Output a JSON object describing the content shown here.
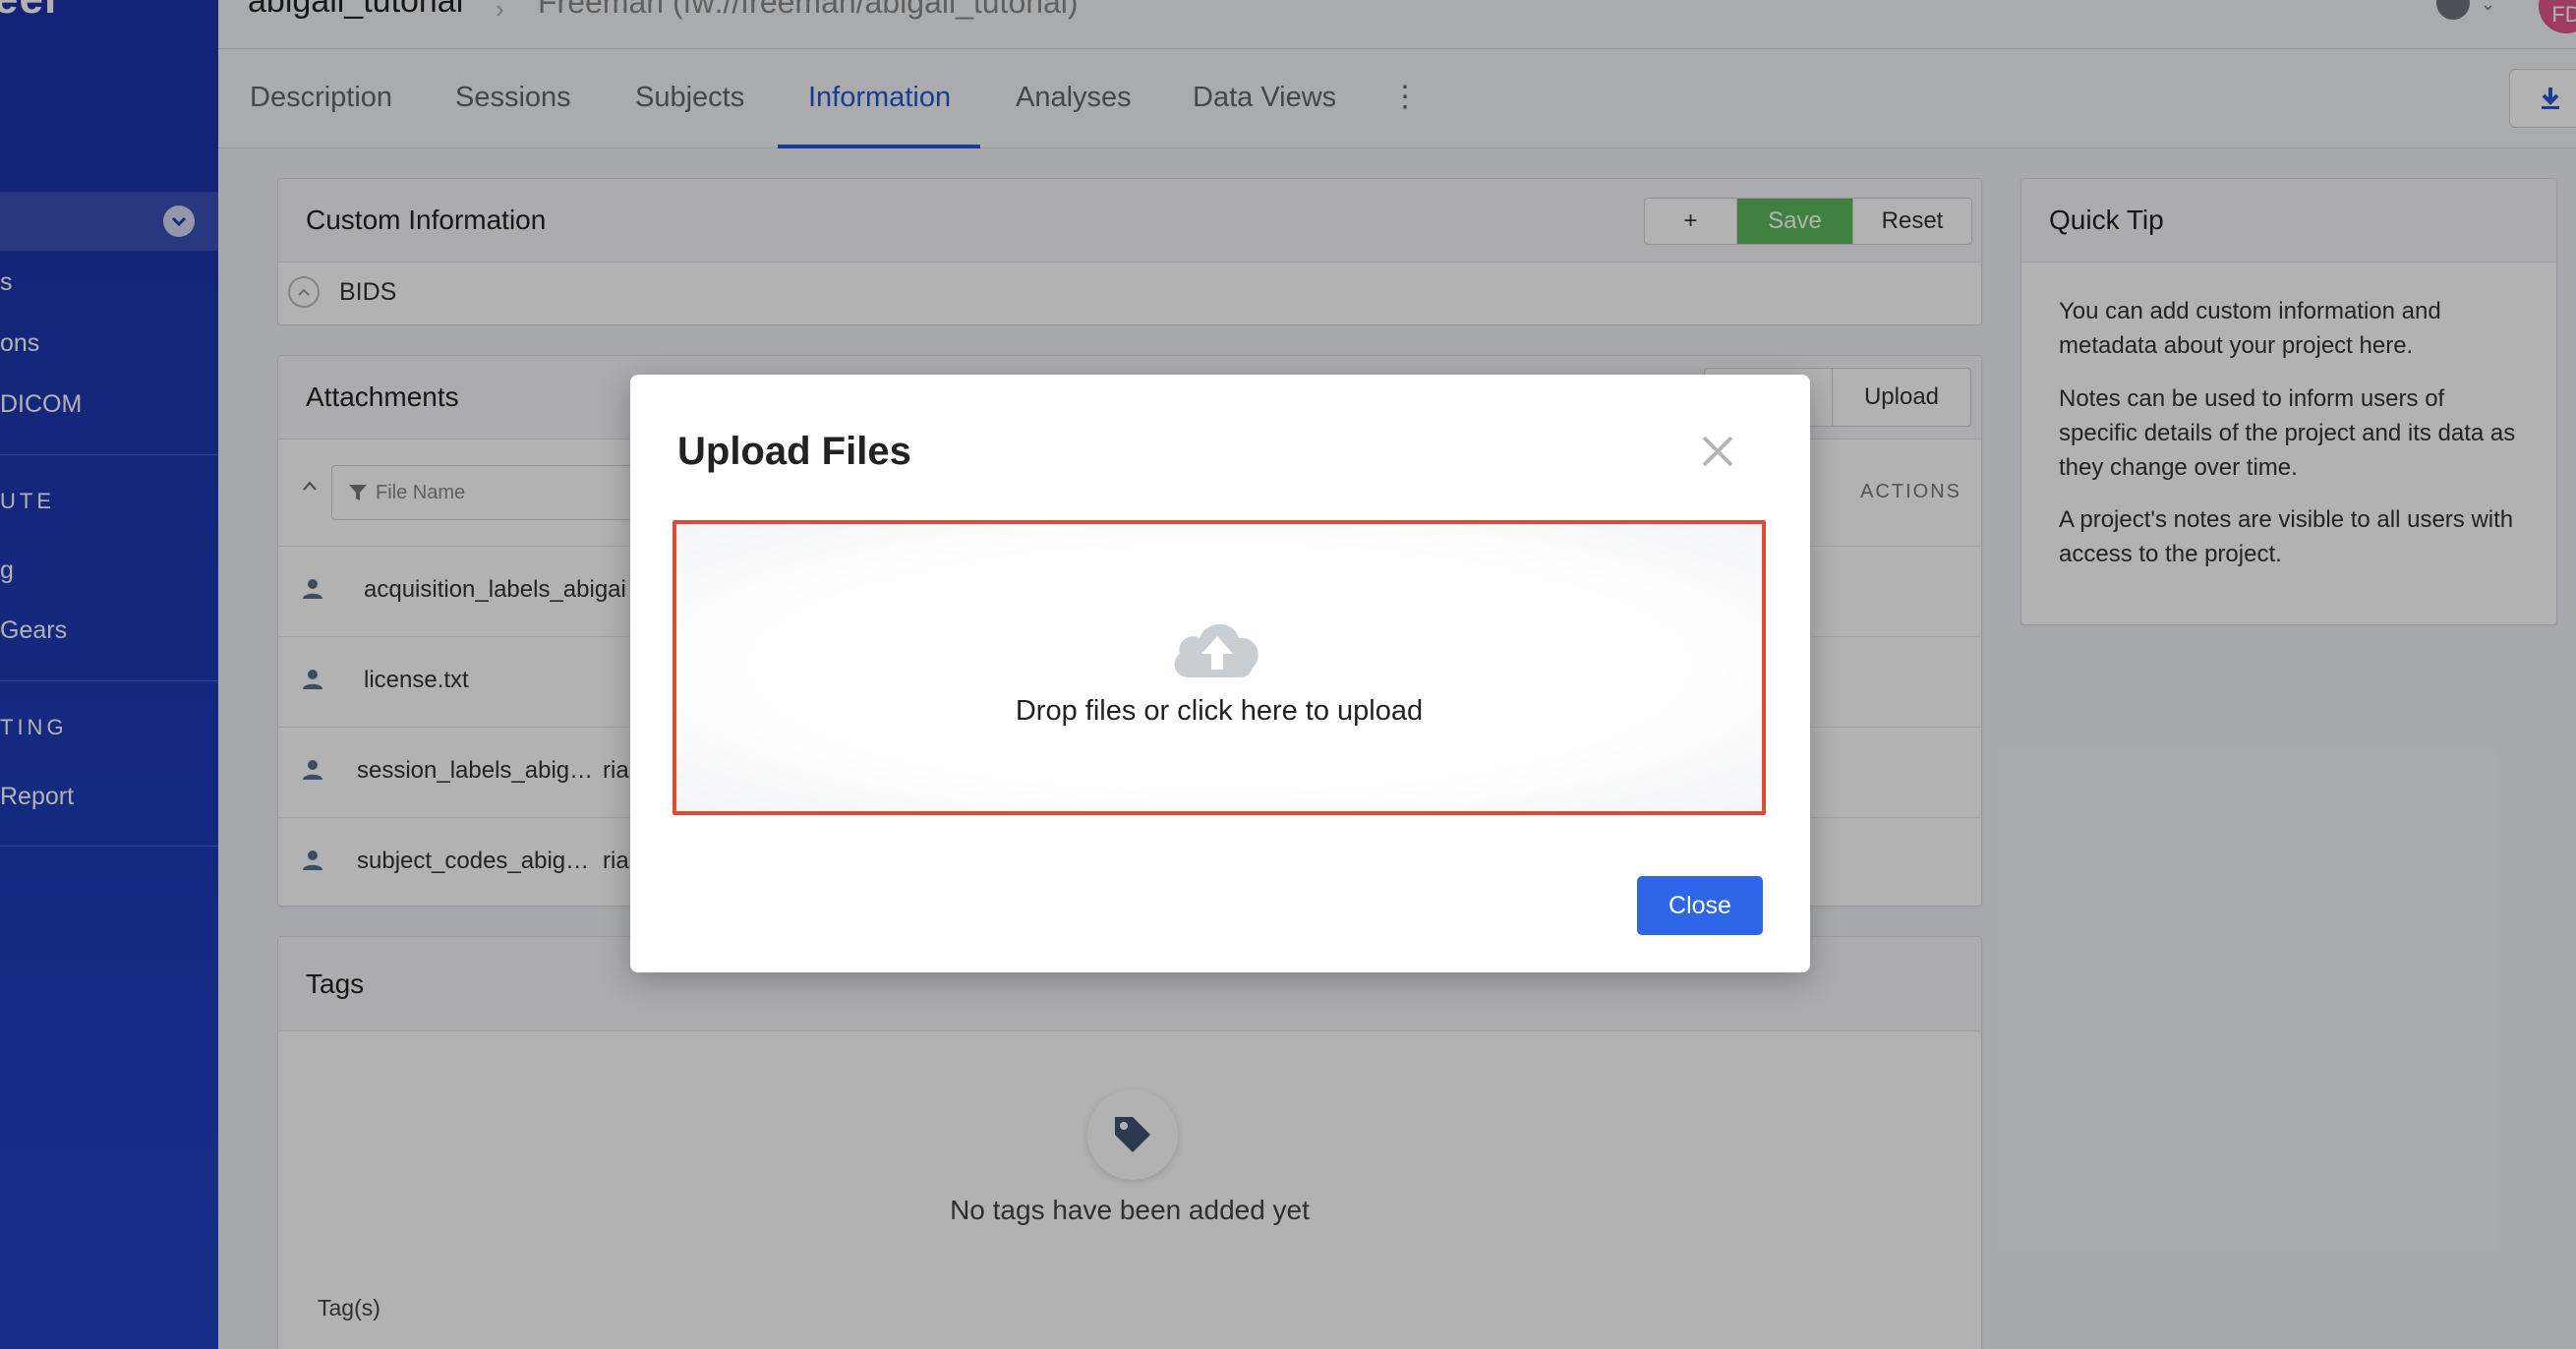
{
  "sidebar": {
    "brand": "eer",
    "items": [
      {
        "label": "s"
      },
      {
        "label": "ons"
      },
      {
        "label": "DICOM"
      },
      {
        "label": "g"
      },
      {
        "label": " Gears"
      },
      {
        "label": "Report"
      }
    ],
    "sections": [
      "UTE",
      "TING"
    ]
  },
  "header": {
    "project": "abigail_tutorial",
    "separator": "›",
    "group_path": "Freeman (fw://freeman/abigail_tutorial)",
    "avatar_initials": "FD"
  },
  "tabs": [
    {
      "label": "Description"
    },
    {
      "label": "Sessions"
    },
    {
      "label": "Subjects"
    },
    {
      "label": "Information",
      "active": true
    },
    {
      "label": "Analyses"
    },
    {
      "label": "Data Views"
    }
  ],
  "custom_info": {
    "title": "Custom Information",
    "add_label": "+",
    "save_label": "Save",
    "reset_label": "Reset",
    "section": "BIDS"
  },
  "attachments": {
    "title": "Attachments",
    "upload_label": "Upload",
    "filter_placeholder": "File Name",
    "actions_header": "ACTIONS",
    "files": [
      {
        "name": "acquisition_labels_abigai",
        "extra": ""
      },
      {
        "name": "license.txt",
        "extra": ""
      },
      {
        "name": "session_labels_abig…",
        "extra": "ria"
      },
      {
        "name": "subject_codes_abig…",
        "extra": "ria"
      }
    ]
  },
  "tags": {
    "title": "Tags",
    "empty_text": "No tags have been added yet",
    "field_label": "Tag(s)"
  },
  "quick_tip": {
    "title": "Quick Tip",
    "paragraphs": [
      "You can add custom information and metadata about your project here.",
      "Notes can be used to inform users of specific details of the project and its data as they change over time.",
      "A project's notes are visible to all users with access to the project."
    ]
  },
  "modal": {
    "title": "Upload Files",
    "dropzone_text": "Drop files or click here to upload",
    "close_label": "Close"
  },
  "colors": {
    "sidebar": "#1e3bb5",
    "accent": "#2356d6",
    "save": "#5cb85c",
    "dropzone_border": "#e04a32",
    "close_button": "#2d66e8"
  }
}
